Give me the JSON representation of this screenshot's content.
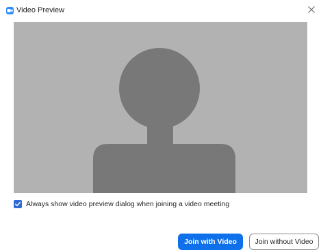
{
  "window": {
    "title": "Video Preview",
    "app_icon": "zoom-video-icon",
    "close_icon": "close-icon"
  },
  "preview": {
    "placeholder": "avatar-silhouette",
    "background_color": "#b2b2b2",
    "silhouette_color": "#787878"
  },
  "options": {
    "always_show_preview_label": "Always show video preview dialog when joining a video meeting",
    "always_show_preview_checked": true
  },
  "actions": {
    "join_with_video_label": "Join with Video",
    "join_without_video_label": "Join without Video"
  },
  "colors": {
    "accent": "#0e71eb",
    "checkbox": "#2d6ad6"
  }
}
